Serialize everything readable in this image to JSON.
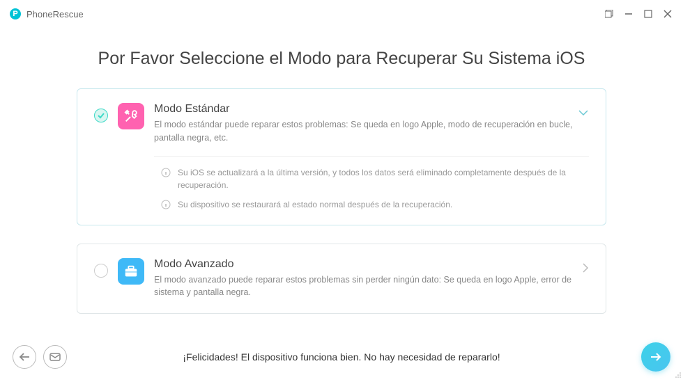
{
  "app": {
    "name": "PhoneRescue"
  },
  "page": {
    "title": "Por Favor Seleccione el Modo para Recuperar Su Sistema iOS"
  },
  "modes": {
    "standard": {
      "title": "Modo Estándar",
      "desc": "El modo estándar puede reparar estos problemas: Se queda en logo Apple, modo de recuperación en bucle, pantalla negra, etc.",
      "details": [
        "Su iOS se actualizará a la última versión, y todos los datos será eliminado completamente después de la recuperación.",
        "Su dispositivo se restaurará al estado normal después de la recuperación."
      ]
    },
    "advanced": {
      "title": "Modo Avanzado",
      "desc": "El modo avanzado puede reparar estos problemas sin perder ningún dato: Se queda en logo Apple, error de sistema y pantalla negra."
    }
  },
  "footer": {
    "message": "¡Felicidades! El dispositivo funciona bien. No hay necesidad de repararlo!"
  }
}
